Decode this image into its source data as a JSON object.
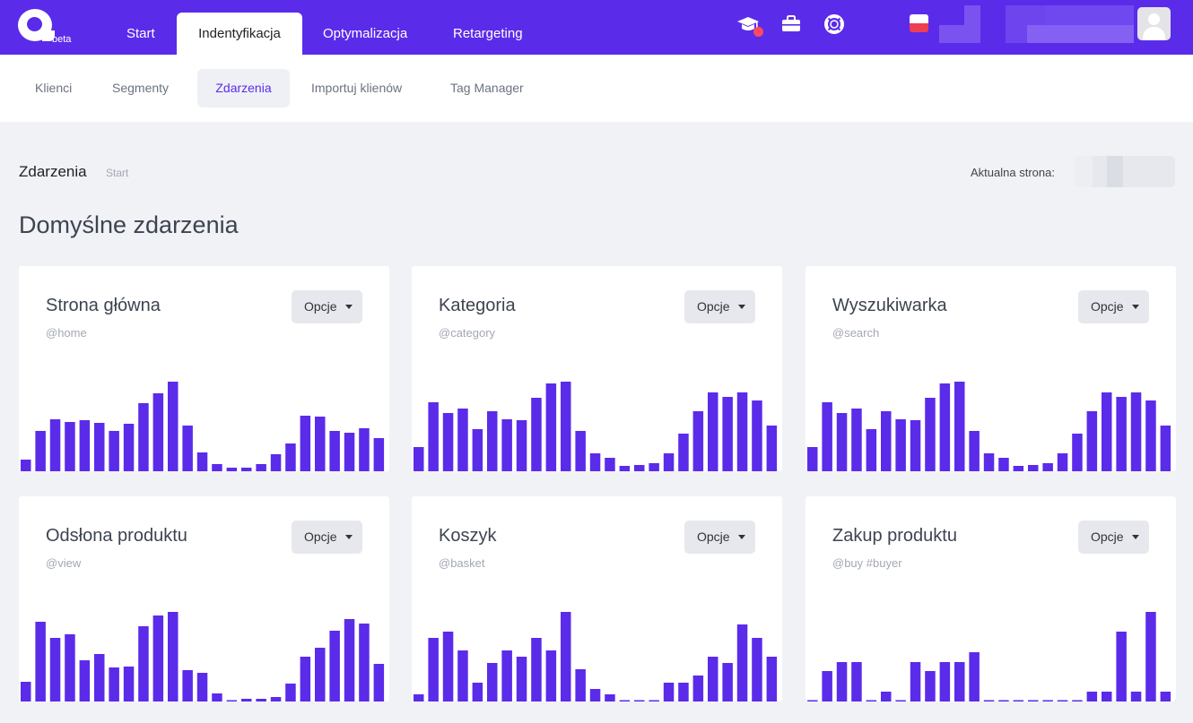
{
  "logo": {
    "beta": "beta"
  },
  "main_tabs": [
    "Start",
    "Indentyfikacja",
    "Optymalizacja",
    "Retargeting"
  ],
  "sub_tabs": [
    "Klienci",
    "Segmenty",
    "Zdarzenia",
    "Importuj klienów",
    "Tag Manager"
  ],
  "page": {
    "title": "Zdarzenia",
    "breadcrumb": "Start",
    "current_label": "Aktualna strona:",
    "section_title": "Domyślne zdarzenia"
  },
  "colors": {
    "accent": "#5b2bea",
    "bar": "#5b2bea",
    "badge": "#ff4a5e"
  },
  "icons": [
    "graduation-cap-icon",
    "briefcase-icon",
    "lifebuoy-icon"
  ],
  "cards": [
    {
      "title": "Strona główna",
      "tag": "@home",
      "button": "Opcje"
    },
    {
      "title": "Kategoria",
      "tag": "@category",
      "button": "Opcje"
    },
    {
      "title": "Wyszukiwarka",
      "tag": "@search",
      "button": "Opcje"
    },
    {
      "title": "Odsłona produktu",
      "tag": "@view",
      "button": "Opcje"
    },
    {
      "title": "Koszyk",
      "tag": "@basket",
      "button": "Opcje"
    },
    {
      "title": "Zakup produktu",
      "tag": "@buy  #buyer",
      "button": "Opcje"
    }
  ],
  "chart_data": [
    {
      "type": "bar",
      "ylim": [
        0,
        100
      ],
      "values": [
        13,
        45,
        58,
        55,
        57,
        54,
        45,
        53,
        76,
        87,
        100,
        51,
        21,
        8,
        4,
        4,
        8,
        19,
        31,
        62,
        61,
        45,
        43,
        48,
        37
      ]
    },
    {
      "type": "bar",
      "ylim": [
        0,
        100
      ],
      "values": [
        27,
        77,
        65,
        70,
        47,
        67,
        58,
        57,
        82,
        98,
        100,
        45,
        20,
        15,
        6,
        7,
        9,
        20,
        42,
        67,
        88,
        83,
        88,
        79,
        51
      ]
    },
    {
      "type": "bar",
      "ylim": [
        0,
        100
      ],
      "values": [
        27,
        77,
        65,
        70,
        47,
        67,
        58,
        57,
        82,
        98,
        100,
        45,
        20,
        15,
        6,
        7,
        9,
        20,
        42,
        67,
        88,
        83,
        88,
        79,
        51
      ]
    },
    {
      "type": "bar",
      "ylim": [
        0,
        100
      ],
      "values": [
        22,
        89,
        71,
        75,
        46,
        53,
        38,
        39,
        84,
        96,
        100,
        35,
        32,
        9,
        1,
        3,
        3,
        5,
        20,
        50,
        60,
        79,
        92,
        87,
        42
      ]
    },
    {
      "type": "bar",
      "ylim": [
        0,
        100
      ],
      "values": [
        8,
        71,
        78,
        57,
        21,
        43,
        57,
        50,
        71,
        57,
        100,
        36,
        14,
        8,
        1,
        1,
        1,
        21,
        21,
        29,
        50,
        43,
        86,
        71,
        50
      ]
    },
    {
      "type": "bar",
      "ylim": [
        0,
        100
      ],
      "values": [
        1,
        34,
        44,
        44,
        1,
        11,
        1,
        44,
        34,
        44,
        44,
        55,
        1,
        1,
        1,
        1,
        1,
        1,
        1,
        11,
        11,
        78,
        11,
        100,
        11,
        1
      ]
    }
  ]
}
